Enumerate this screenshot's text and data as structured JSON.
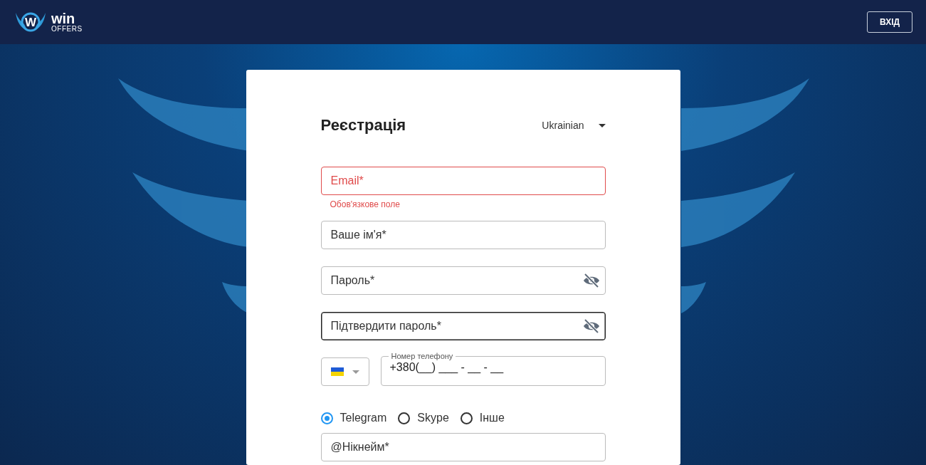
{
  "header": {
    "logo": {
      "mark": "W",
      "word": "win",
      "sub": "OFFERS"
    },
    "login_button": "ВХІД"
  },
  "form": {
    "title": "Реєстрація",
    "language": "Ukrainian",
    "fields": [
      {
        "kind": "text",
        "placeholder": "Email*",
        "error": "Обов'язкове поле",
        "focused": false
      },
      {
        "kind": "text",
        "placeholder": "Ваше ім'я*",
        "focused": false
      },
      {
        "kind": "password",
        "placeholder": "Пароль*",
        "focused": false
      },
      {
        "kind": "password",
        "placeholder": "Підтвердити пароль*",
        "focused": true
      }
    ],
    "phone": {
      "label": "Номер телефону",
      "value": "+380(__) ___ - __ - __"
    },
    "messengers": [
      {
        "label": "Telegram",
        "selected": true
      },
      {
        "label": "Skype",
        "selected": false
      },
      {
        "label": "Інше",
        "selected": false
      }
    ],
    "nickname": {
      "placeholder": "@Нікнейм*"
    }
  }
}
